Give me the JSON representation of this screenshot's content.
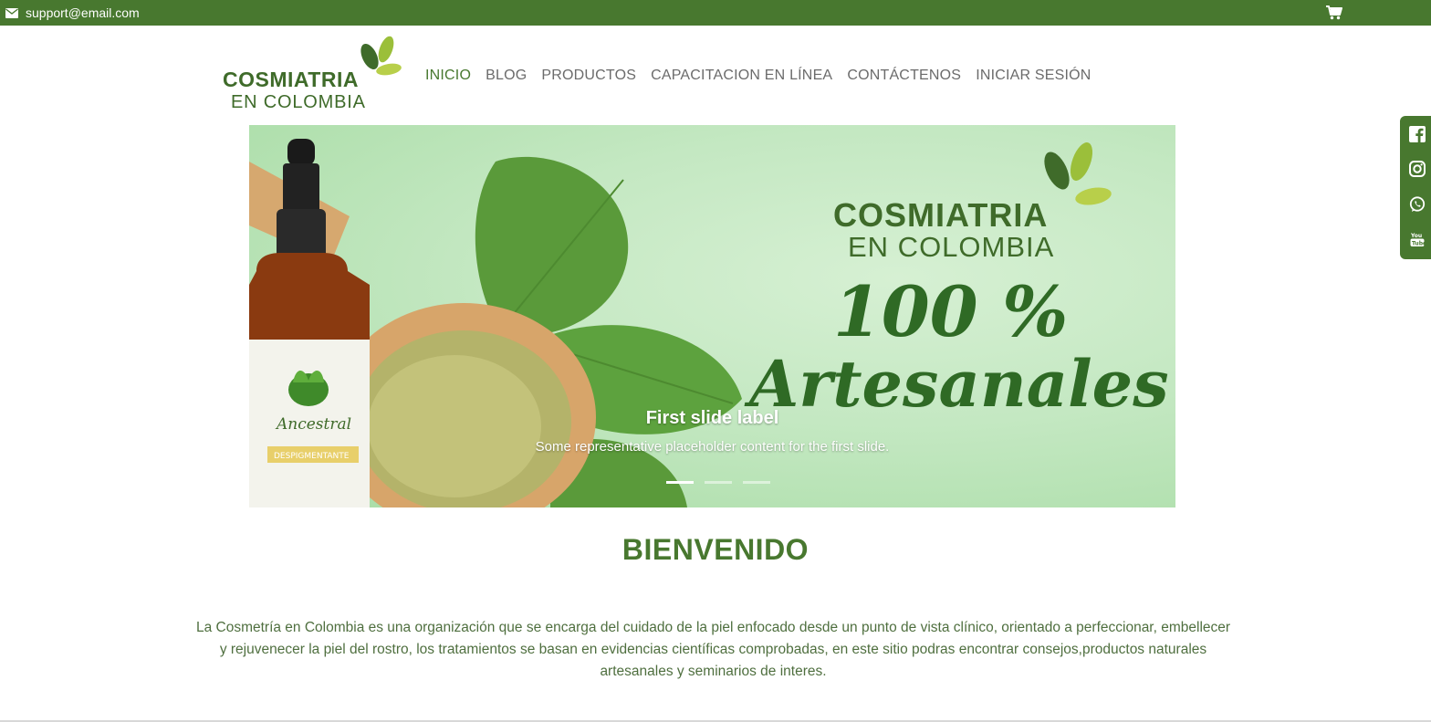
{
  "topbar": {
    "email": "support@email.com",
    "mail_icon": "envelope-icon",
    "cart_icon": "shopping-cart-icon",
    "color": "#48782f"
  },
  "logo": {
    "line1": "COSMIATRIA",
    "line2": "EN COLOMBIA"
  },
  "nav": {
    "items": [
      {
        "label": "INICIO",
        "active": true
      },
      {
        "label": "BLOG",
        "active": false
      },
      {
        "label": "PRODUCTOS",
        "active": false
      },
      {
        "label": "CAPACITACION EN LÍNEA",
        "active": false
      },
      {
        "label": "CONTÁCTENOS",
        "active": false
      },
      {
        "label": "INICIAR SESIÓN",
        "active": false
      }
    ]
  },
  "social": {
    "icons": [
      "facebook-icon",
      "instagram-icon",
      "whatsapp-icon",
      "youtube-icon"
    ]
  },
  "carousel": {
    "brand_line1": "COSMIATRIA",
    "brand_line2": "EN COLOMBIA",
    "tagline1": "100 %",
    "tagline2": "Artesanales",
    "product_label": "Ancestral",
    "product_sublabel": "DESPIGMENTANTE",
    "caption_title": "First slide label",
    "caption_text": "Some representative placeholder content for the first slide.",
    "slide_count": 3,
    "active_slide": 1
  },
  "welcome": {
    "title": "BIENVENIDO",
    "text": "La Cosmetría en Colombia es una organización que se encarga del cuidado de la piel enfocado desde un punto de vista clínico, orientado a perfeccionar, embellecer y rejuvenecer la piel del rostro, los tratamientos se basan en evidencias científicas comprobadas, en este sitio podras encontrar consejos,productos naturales artesanales y seminarios de interes."
  }
}
